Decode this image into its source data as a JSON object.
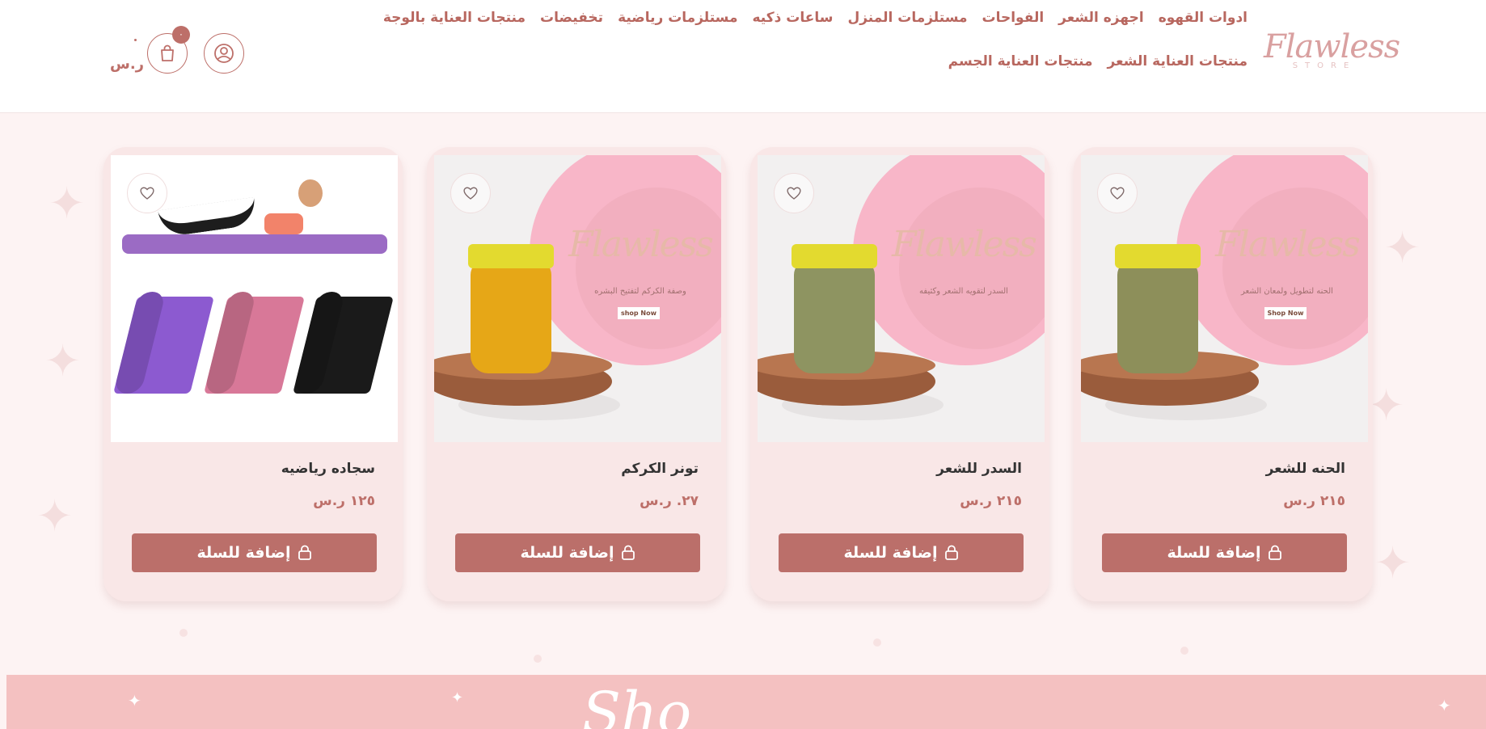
{
  "header": {
    "logo_text": "Flawless",
    "logo_sub": "STORE",
    "nav_row1": [
      "ادوات القهوه",
      "اجهزه الشعر",
      "الفواحات",
      "مستلزمات المنزل",
      "ساعات ذكيه",
      "مستلزمات رياضية",
      "تخفيضات",
      "منتجات العناية بالوجة",
      "منتجات العناية الشعر"
    ],
    "nav_row2": [
      "منتجات العناية الجسم"
    ],
    "cart_count": "٠",
    "cart_total": "ر.س",
    "cart_total_amount": "."
  },
  "products": [
    {
      "title": "الحنه للشعر",
      "price": "٢١٥ ر.س",
      "add_label": "إضافة للسلة",
      "image": {
        "type": "jar",
        "jar_color": "#8d8f5a",
        "tagline": "الحنه لتطويل ولمعان الشعر",
        "logo": "Flawless",
        "cta": "Shop Now"
      }
    },
    {
      "title": "السدر للشعر",
      "price": "٢١٥ ر.س",
      "add_label": "إضافة للسلة",
      "image": {
        "type": "jar",
        "jar_color": "#8e9461",
        "tagline": "السدر لتقويه الشعر وكثيفه",
        "logo": "Flawless",
        "cta": "Shop Now"
      }
    },
    {
      "title": "تونر الكركم",
      "price": "٢٧. ر.س",
      "add_label": "إضافة للسلة",
      "image": {
        "type": "jar",
        "jar_color": "#e6a717",
        "tagline": "وصفة الكركم لتفتيح البشره",
        "logo": "Flawless",
        "cta": "shop Now"
      }
    },
    {
      "title": "سجاده رياضيه",
      "price": "١٢٥ ر.س",
      "add_label": "إضافة للسلة",
      "image": {
        "type": "mats",
        "mat_colors": [
          "#8c5ad0",
          "#d87898",
          "#1a1a1a"
        ]
      }
    }
  ],
  "banner": {
    "text": "Sho"
  },
  "colors": {
    "accent": "#bb6f6a",
    "card_bg": "#f9e7e7",
    "banner_bg": "#f4c1c1"
  }
}
